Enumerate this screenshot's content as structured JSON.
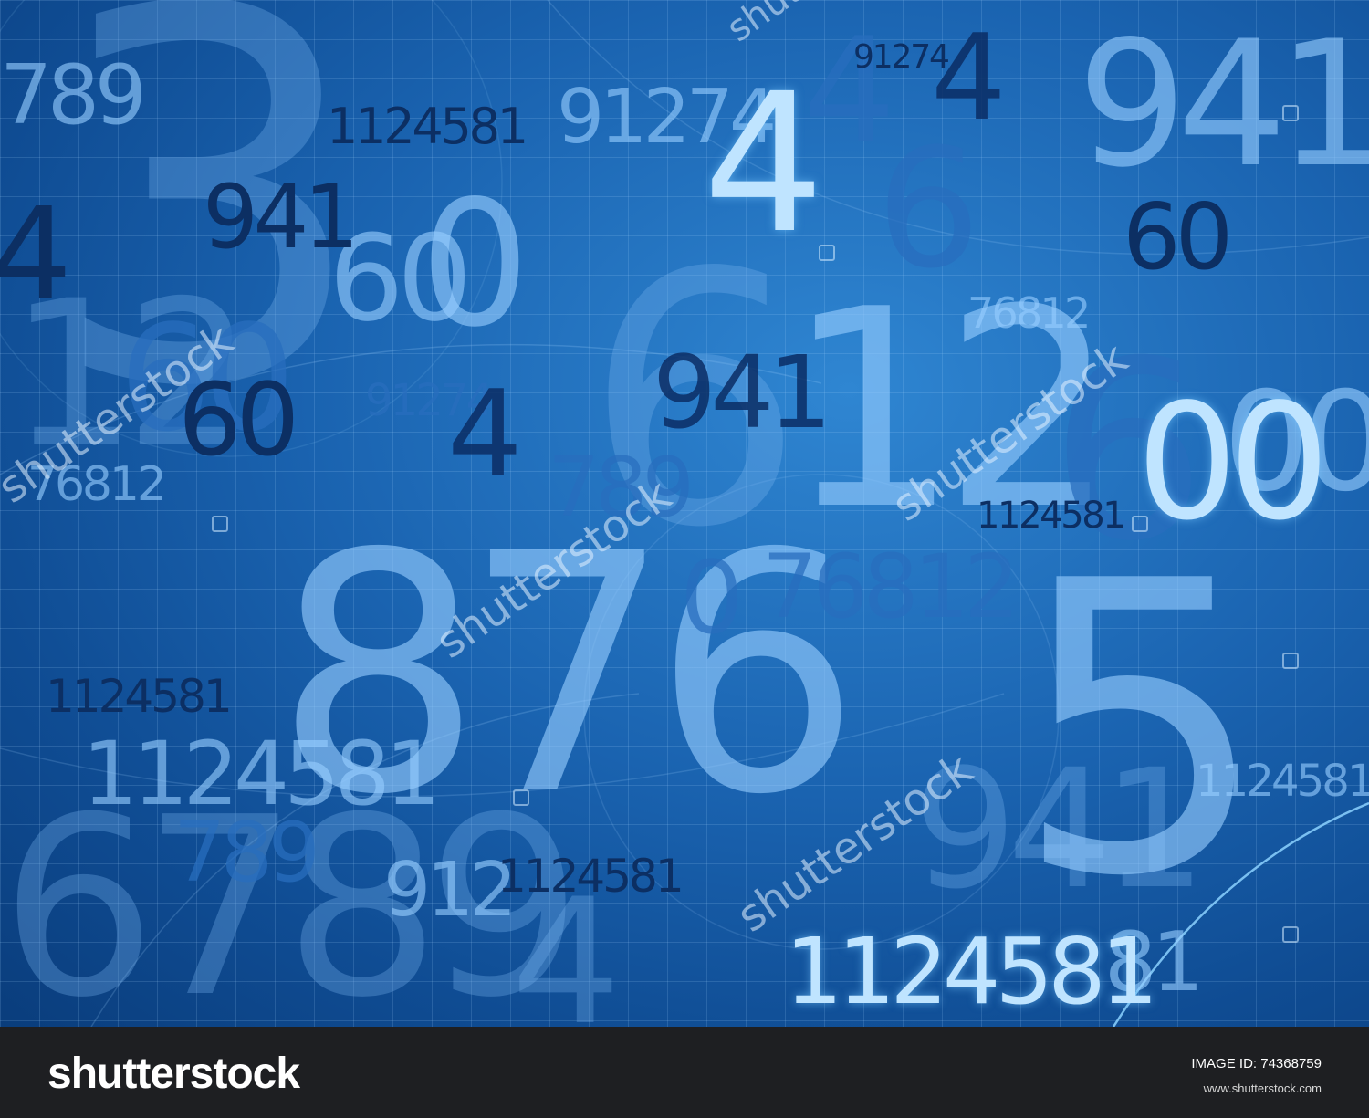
{
  "numbers": {
    "n_1124581_a": "1124581",
    "n_91274_a": "91274",
    "n_4_a": "4",
    "n_4_b": "4",
    "n_941_a": "941",
    "n_789_a": "789",
    "n_941_b": "941",
    "n_0_a": "0",
    "n_60_a": "60",
    "n_4_c": "4",
    "n_3_a": "3",
    "n_12_a": "12",
    "n_60_b": "60",
    "n_91274_b": "91274",
    "n_4_d": "4",
    "n_941_c": "941",
    "n_76812_a": "76812",
    "n_76812_b": "76812",
    "n_6_a": "6",
    "n_00_a": "00",
    "n_00_b": "00",
    "n_1124581_b": "1124581",
    "n_789_b": "789",
    "n_876_a": "876",
    "n_0_b": "0",
    "n_76812_c": "76812",
    "n_5_a": "5",
    "n_1124581_c": "1124581",
    "n_1124581_d": "1124581",
    "n_1124581_e": "1124581",
    "n_6789_a": "6789",
    "n_1124581_f": "1124581",
    "n_912_a": "912",
    "n_4_e": "4",
    "n_941_d": "941",
    "n_1124581_g": "1124581",
    "n_81_a": "81"
  },
  "watermark": {
    "text": "shutterstock"
  },
  "footer": {
    "logo": "shutterstock",
    "image_id_label": "IMAGE ID:",
    "image_id": "74368759",
    "url": "www.shutterstock.com"
  },
  "colors": {
    "background_blue": "#1a63b0",
    "bright_digit": "#bfe4ff",
    "dark_digit": "#0c2f63",
    "footer_bg": "#1e1f22"
  }
}
